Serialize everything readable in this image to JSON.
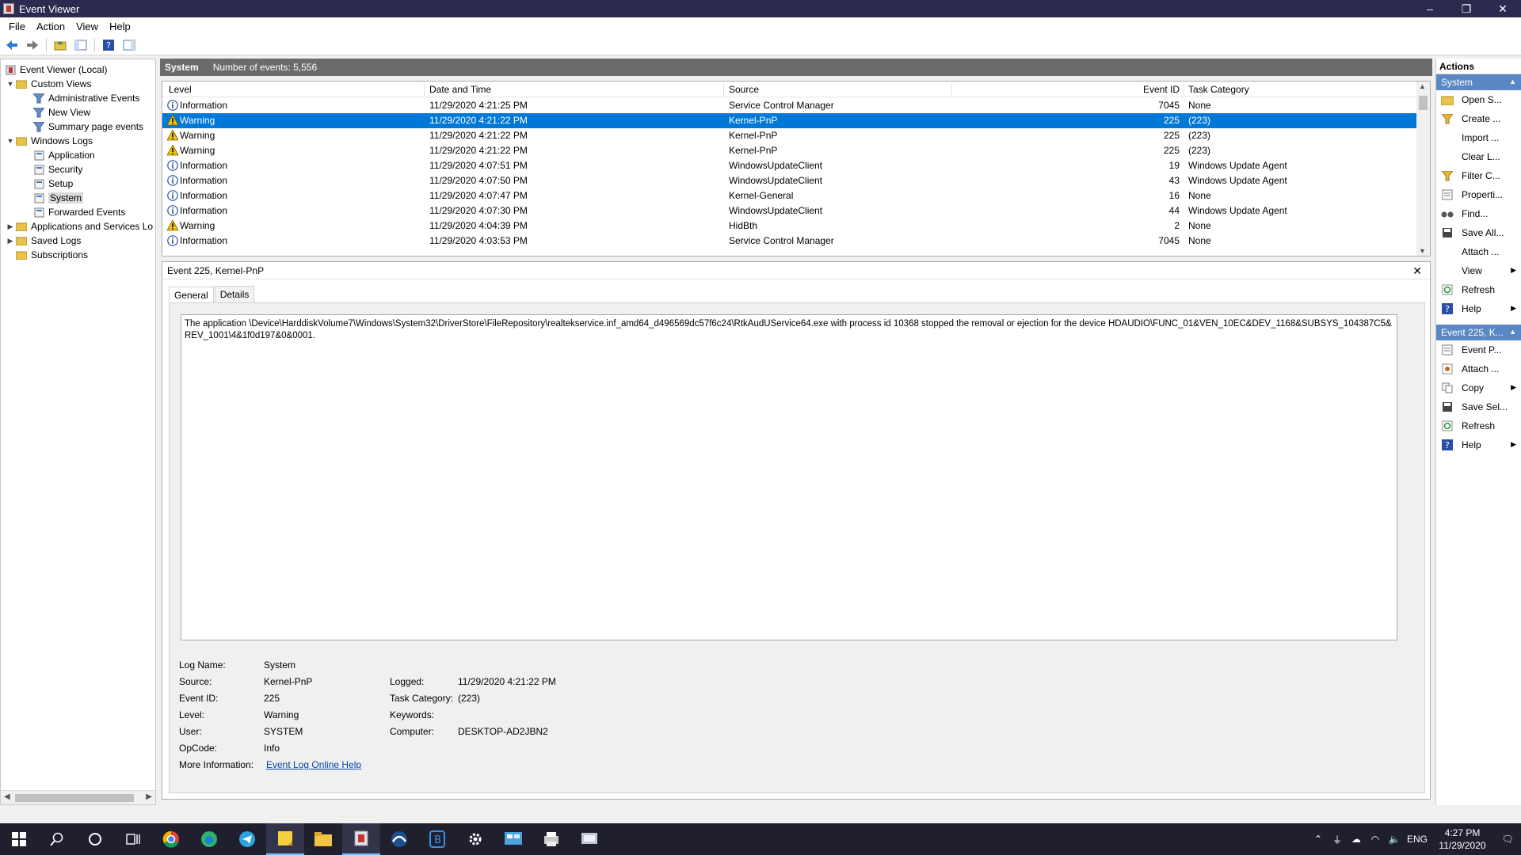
{
  "window": {
    "title": "Event Viewer",
    "minimize": "–",
    "maximize": "❐",
    "close": "✕"
  },
  "menu": [
    "File",
    "Action",
    "View",
    "Help"
  ],
  "tree": {
    "root": "Event Viewer (Local)",
    "custom_views": "Custom Views",
    "administrative_events": "Administrative Events",
    "new_view": "New View",
    "summary_page_events": "Summary page events",
    "windows_logs": "Windows Logs",
    "application": "Application",
    "security": "Security",
    "setup": "Setup",
    "system": "System",
    "forwarded_events": "Forwarded Events",
    "applications_services": "Applications and Services Lo",
    "saved_logs": "Saved Logs",
    "subscriptions": "Subscriptions"
  },
  "center": {
    "log_name": "System",
    "event_count": "Number of events: 5,556",
    "columns": [
      "Level",
      "Date and Time",
      "Source",
      "Event ID",
      "Task Category"
    ],
    "rows": [
      {
        "level": "Information",
        "date": "11/29/2020 4:21:25 PM",
        "source": "Service Control Manager",
        "id": "7045",
        "category": "None"
      },
      {
        "level": "Warning",
        "date": "11/29/2020 4:21:22 PM",
        "source": "Kernel-PnP",
        "id": "225",
        "category": "(223)"
      },
      {
        "level": "Warning",
        "date": "11/29/2020 4:21:22 PM",
        "source": "Kernel-PnP",
        "id": "225",
        "category": "(223)"
      },
      {
        "level": "Warning",
        "date": "11/29/2020 4:21:22 PM",
        "source": "Kernel-PnP",
        "id": "225",
        "category": "(223)"
      },
      {
        "level": "Information",
        "date": "11/29/2020 4:07:51 PM",
        "source": "WindowsUpdateClient",
        "id": "19",
        "category": "Windows Update Agent"
      },
      {
        "level": "Information",
        "date": "11/29/2020 4:07:50 PM",
        "source": "WindowsUpdateClient",
        "id": "43",
        "category": "Windows Update Agent"
      },
      {
        "level": "Information",
        "date": "11/29/2020 4:07:47 PM",
        "source": "Kernel-General",
        "id": "16",
        "category": "None"
      },
      {
        "level": "Information",
        "date": "11/29/2020 4:07:30 PM",
        "source": "WindowsUpdateClient",
        "id": "44",
        "category": "Windows Update Agent"
      },
      {
        "level": "Warning",
        "date": "11/29/2020 4:04:39 PM",
        "source": "HidBth",
        "id": "2",
        "category": "None"
      },
      {
        "level": "Information",
        "date": "11/29/2020 4:03:53 PM",
        "source": "Service Control Manager",
        "id": "7045",
        "category": "None"
      }
    ],
    "selected_row": 1
  },
  "detail": {
    "title": "Event 225, Kernel-PnP",
    "close": "✕",
    "tabs": [
      "General",
      "Details"
    ],
    "description": "The application \\Device\\HarddiskVolume7\\Windows\\System32\\DriverStore\\FileRepository\\realtekservice.inf_amd64_d496569dc57f6c24\\RtkAudUService64.exe with process id 10368 stopped the removal or ejection for the device HDAUDIO\\FUNC_01&VEN_10EC&DEV_1168&SUBSYS_104387C5&REV_1001\\4&1f0d197&0&0001.",
    "labels": {
      "log_name": "Log Name:",
      "source": "Source:",
      "event_id": "Event ID:",
      "level": "Level:",
      "user": "User:",
      "opcode": "OpCode:",
      "more_info": "More Information:",
      "logged": "Logged:",
      "task_category": "Task Category:",
      "keywords": "Keywords:",
      "computer": "Computer:"
    },
    "values": {
      "log_name": "System",
      "source": "Kernel-PnP",
      "event_id": "225",
      "level": "Warning",
      "user": "SYSTEM",
      "opcode": "Info",
      "more_info_link": "Event Log Online Help",
      "logged": "11/29/2020 4:21:22 PM",
      "task_category": "(223)",
      "keywords": "",
      "computer": "DESKTOP-AD2JBN2"
    }
  },
  "actions": {
    "title": "Actions",
    "section1": "System",
    "section1_items": [
      "Open S...",
      "Create ...",
      "Import ...",
      "Clear L...",
      "Filter C...",
      "Properti...",
      "Find...",
      "Save All...",
      "Attach ...",
      "View",
      "Refresh",
      "Help"
    ],
    "section2": "Event 225, K...",
    "section2_items": [
      "Event P...",
      "Attach ...",
      "Copy",
      "Save Sel...",
      "Refresh",
      "Help"
    ]
  },
  "taskbar": {
    "lang": "ENG",
    "time": "4:27 PM",
    "date": "11/29/2020"
  },
  "colors": {
    "selection": "#0078d7",
    "title_bar": "#2b2b4f",
    "actions_header": "#5a88c4",
    "taskbar": "#1f1f2e"
  }
}
